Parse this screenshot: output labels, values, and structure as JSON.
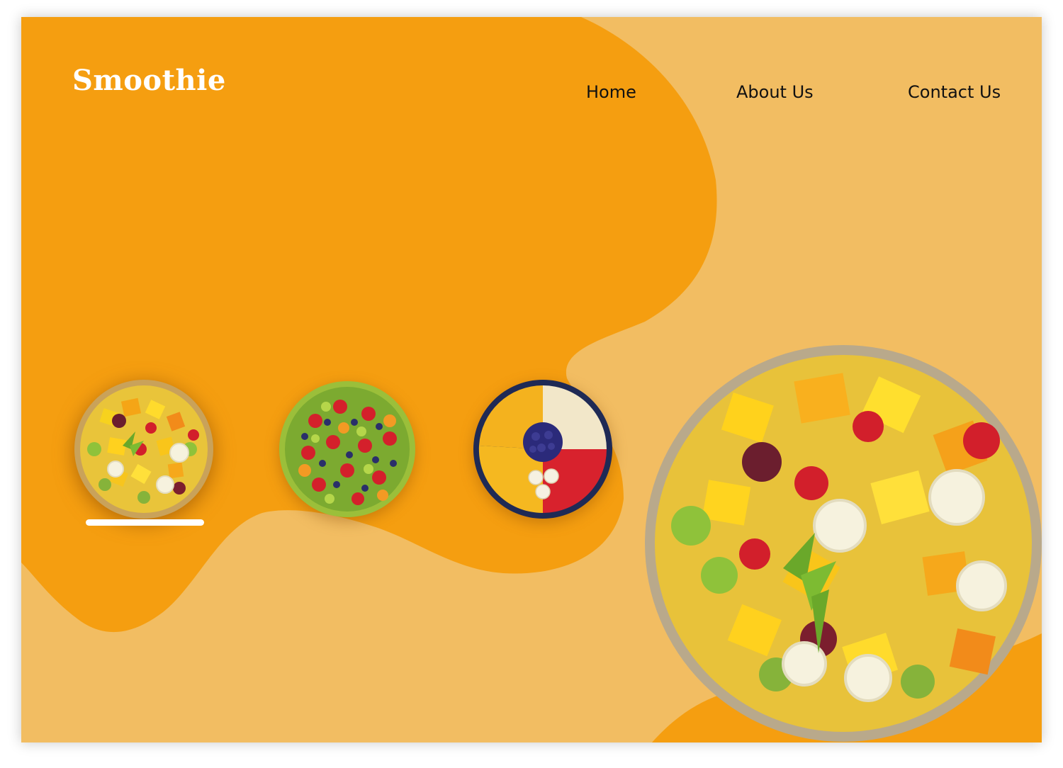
{
  "brand": {
    "logo": "Smoothie"
  },
  "nav": {
    "home": "Home",
    "about": "About Us",
    "contact": "Contact Us"
  },
  "colors": {
    "primary_orange": "#f59e10",
    "light_orange": "#f2bd62",
    "logo_text": "#ffffff",
    "nav_text": "#111111",
    "active_indicator": "#ffffff"
  },
  "gallery": {
    "active_index": 0,
    "thumbnails": [
      {
        "icon": "fruit-salad-bowl-icon",
        "selected": true
      },
      {
        "icon": "mixed-berry-platter-icon",
        "selected": false
      },
      {
        "icon": "fruit-plate-icon",
        "selected": false
      }
    ],
    "hero_icon": "fruit-salad-bowl-icon"
  }
}
